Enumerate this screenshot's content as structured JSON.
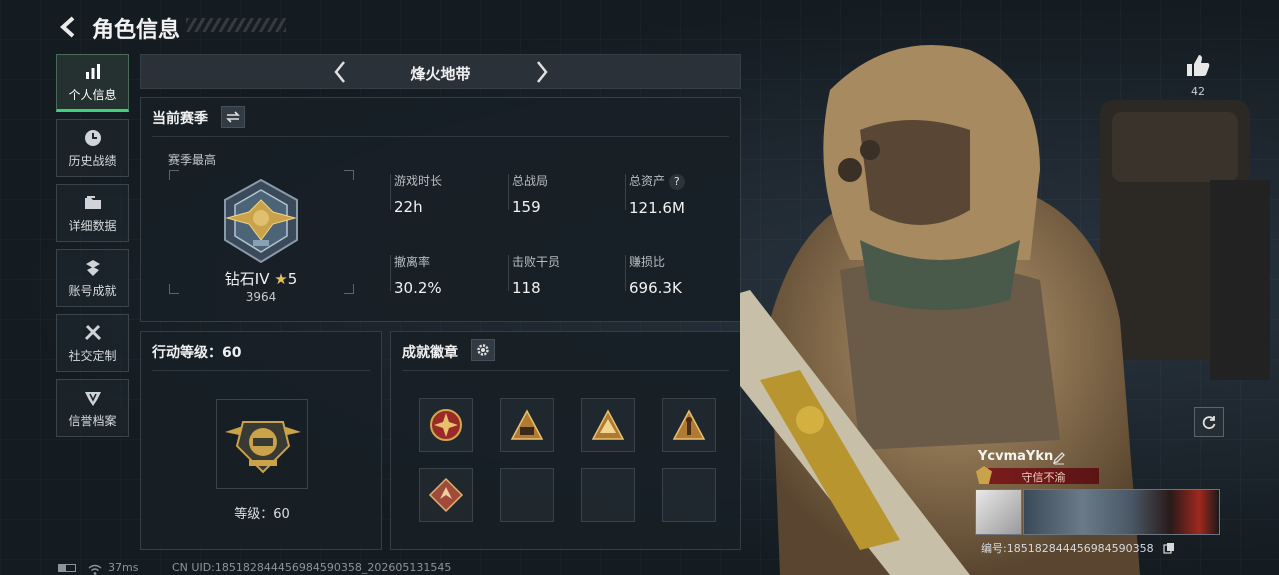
{
  "header": {
    "title": "角色信息"
  },
  "nav": {
    "items": [
      {
        "label": "个人信息",
        "icon": "bar-chart-icon",
        "active": true
      },
      {
        "label": "历史战绩",
        "icon": "clock-icon"
      },
      {
        "label": "详细数据",
        "icon": "folder-icon"
      },
      {
        "label": "账号成就",
        "icon": "medal-icon"
      },
      {
        "label": "社交定制",
        "icon": "tools-icon"
      },
      {
        "label": "信誉档案",
        "icon": "shield-icon"
      }
    ]
  },
  "mode": {
    "title": "烽火地带"
  },
  "season": {
    "title": "当前赛季",
    "best_label": "赛季最高",
    "rank_name": "钻石IV",
    "rank_stars": "5",
    "rank_score": "3964",
    "stats": [
      {
        "label": "游戏时长",
        "value": "22h"
      },
      {
        "label": "总战局",
        "value": "159"
      },
      {
        "label": "总资产",
        "value": "121.6M"
      },
      {
        "label": "撤离率",
        "value": "30.2%"
      },
      {
        "label": "击败干员",
        "value": "118"
      },
      {
        "label": "赚损比",
        "value": "696.3K"
      }
    ],
    "help_icon": "?"
  },
  "action_level": {
    "title": "行动等级：60",
    "level_text": "等级：60"
  },
  "achievements": {
    "title": "成就徽章"
  },
  "profile": {
    "likes": "42",
    "name": "YcvmaYkn",
    "tag": "守信不渝",
    "id_text": "编号:185182844456984590358"
  },
  "footer": {
    "ping": "37ms",
    "uid_text": "CN UID:185182844456984590358_202605131545"
  },
  "colors": {
    "accent_green": "#3cd27a",
    "gold": "#c9a24a",
    "tag_red": "#7a1c1c"
  }
}
